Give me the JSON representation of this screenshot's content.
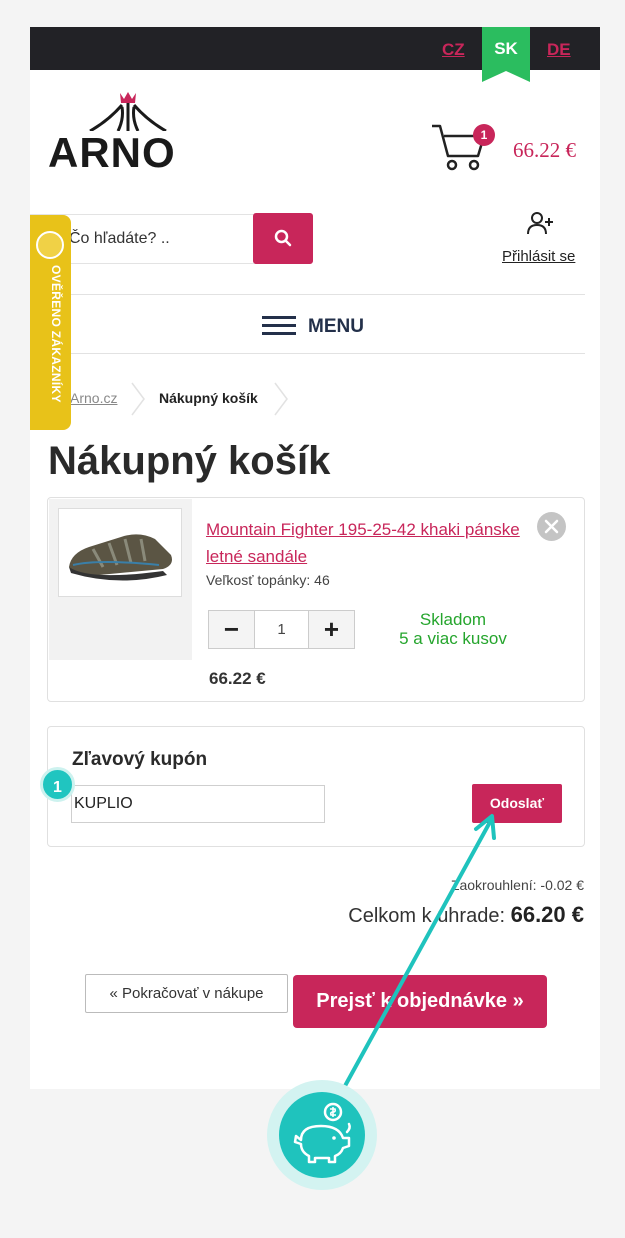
{
  "header": {
    "languages": {
      "cz": "CZ",
      "sk": "SK",
      "de": "DE"
    },
    "logo_text": "ARNO",
    "cart_count": "1",
    "cart_total": "66.22 €"
  },
  "search": {
    "placeholder": "Čo hľadáte? .."
  },
  "login": {
    "label": "Přihlásit se"
  },
  "menu": {
    "label": "MENU"
  },
  "verified_badge": {
    "text": "OVĚŘENO ZÁKAZNÍKY"
  },
  "breadcrumb": {
    "home": "Arno.cz",
    "current": "Nákupný košík"
  },
  "page_title": "Nákupný košík",
  "cart_item": {
    "name": "Mountain Fighter 195-25-42 khaki pánske letné sandále",
    "size": "Veľkosť topánky: 46",
    "quantity": "1",
    "stock_line1": "Skladom",
    "stock_line2": "5 a viac kusov",
    "price": "66.22 €"
  },
  "coupon": {
    "title": "Zľavový kupón",
    "code": "KUPLIO",
    "submit_label": "Odoslať"
  },
  "summary": {
    "rounding": "Zaokrouhlení: -0.02 €",
    "total_label": "Celkom k úhrade:",
    "total_value": "66.20 €"
  },
  "actions": {
    "continue_label": "« Pokračovať v nákupe",
    "order_label": "Prejsť k objednávke »"
  },
  "overlay": {
    "step_number": "1"
  },
  "colors": {
    "brand": "#c8265a",
    "active_lang": "#2bbd5f",
    "stock": "#25a52d",
    "overlay": "#1fc3bd",
    "badge": "#e8c219"
  }
}
